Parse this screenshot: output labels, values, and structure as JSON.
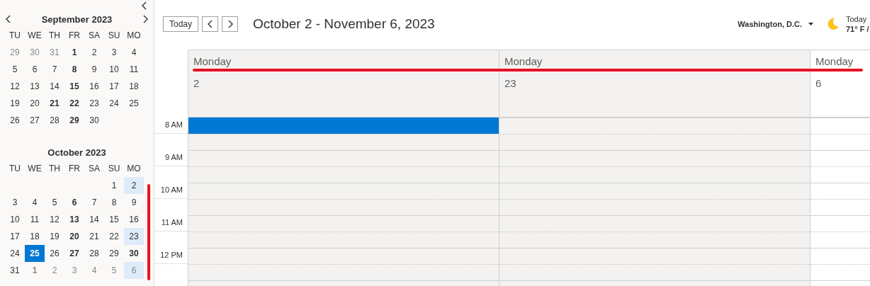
{
  "sidebar": {
    "mini_calendars": [
      {
        "title": "September 2023",
        "weekdays": [
          "TU",
          "WE",
          "TH",
          "FR",
          "SA",
          "SU",
          "MO"
        ],
        "weeks": [
          [
            {
              "d": "29",
              "muted": true,
              "bold": false,
              "selected": false,
              "today": false
            },
            {
              "d": "30",
              "muted": true,
              "bold": false,
              "selected": false,
              "today": false
            },
            {
              "d": "31",
              "muted": true,
              "bold": false,
              "selected": false,
              "today": false
            },
            {
              "d": "1",
              "muted": false,
              "bold": true,
              "selected": false,
              "today": false
            },
            {
              "d": "2",
              "muted": false,
              "bold": false,
              "selected": false,
              "today": false
            },
            {
              "d": "3",
              "muted": false,
              "bold": false,
              "selected": false,
              "today": false
            },
            {
              "d": "4",
              "muted": false,
              "bold": false,
              "selected": false,
              "today": false
            }
          ],
          [
            {
              "d": "5",
              "muted": false,
              "bold": false,
              "selected": false,
              "today": false
            },
            {
              "d": "6",
              "muted": false,
              "bold": false,
              "selected": false,
              "today": false
            },
            {
              "d": "7",
              "muted": false,
              "bold": false,
              "selected": false,
              "today": false
            },
            {
              "d": "8",
              "muted": false,
              "bold": true,
              "selected": false,
              "today": false
            },
            {
              "d": "9",
              "muted": false,
              "bold": false,
              "selected": false,
              "today": false
            },
            {
              "d": "10",
              "muted": false,
              "bold": false,
              "selected": false,
              "today": false
            },
            {
              "d": "11",
              "muted": false,
              "bold": false,
              "selected": false,
              "today": false
            }
          ],
          [
            {
              "d": "12",
              "muted": false,
              "bold": false,
              "selected": false,
              "today": false
            },
            {
              "d": "13",
              "muted": false,
              "bold": false,
              "selected": false,
              "today": false
            },
            {
              "d": "14",
              "muted": false,
              "bold": false,
              "selected": false,
              "today": false
            },
            {
              "d": "15",
              "muted": false,
              "bold": true,
              "selected": false,
              "today": false
            },
            {
              "d": "16",
              "muted": false,
              "bold": false,
              "selected": false,
              "today": false
            },
            {
              "d": "17",
              "muted": false,
              "bold": false,
              "selected": false,
              "today": false
            },
            {
              "d": "18",
              "muted": false,
              "bold": false,
              "selected": false,
              "today": false
            }
          ],
          [
            {
              "d": "19",
              "muted": false,
              "bold": false,
              "selected": false,
              "today": false
            },
            {
              "d": "20",
              "muted": false,
              "bold": false,
              "selected": false,
              "today": false
            },
            {
              "d": "21",
              "muted": false,
              "bold": true,
              "selected": false,
              "today": false
            },
            {
              "d": "22",
              "muted": false,
              "bold": true,
              "selected": false,
              "today": false
            },
            {
              "d": "23",
              "muted": false,
              "bold": false,
              "selected": false,
              "today": false
            },
            {
              "d": "24",
              "muted": false,
              "bold": false,
              "selected": false,
              "today": false
            },
            {
              "d": "25",
              "muted": false,
              "bold": false,
              "selected": false,
              "today": false
            }
          ],
          [
            {
              "d": "26",
              "muted": false,
              "bold": false,
              "selected": false,
              "today": false
            },
            {
              "d": "27",
              "muted": false,
              "bold": false,
              "selected": false,
              "today": false
            },
            {
              "d": "28",
              "muted": false,
              "bold": false,
              "selected": false,
              "today": false
            },
            {
              "d": "29",
              "muted": false,
              "bold": true,
              "selected": false,
              "today": false
            },
            {
              "d": "30",
              "muted": false,
              "bold": false,
              "selected": false,
              "today": false
            }
          ]
        ]
      },
      {
        "title": "October 2023",
        "weekdays": [
          "TU",
          "WE",
          "TH",
          "FR",
          "SA",
          "SU",
          "MO"
        ],
        "weeks": [
          [
            {
              "kind": "blank"
            },
            {
              "kind": "blank"
            },
            {
              "kind": "blank"
            },
            {
              "kind": "blank"
            },
            {
              "kind": "blank"
            },
            {
              "kind": "day",
              "d": "1",
              "muted": false,
              "bold": false,
              "selected": false,
              "today": false
            },
            {
              "kind": "day",
              "d": "2",
              "muted": false,
              "bold": false,
              "selected": true,
              "today": false
            }
          ],
          [
            {
              "kind": "day",
              "d": "3",
              "muted": false,
              "bold": false,
              "selected": false,
              "today": false
            },
            {
              "kind": "day",
              "d": "4",
              "muted": false,
              "bold": false,
              "selected": false,
              "today": false
            },
            {
              "kind": "day",
              "d": "5",
              "muted": false,
              "bold": false,
              "selected": false,
              "today": false
            },
            {
              "kind": "day",
              "d": "6",
              "muted": false,
              "bold": true,
              "selected": false,
              "today": false
            },
            {
              "kind": "day",
              "d": "7",
              "muted": false,
              "bold": false,
              "selected": false,
              "today": false
            },
            {
              "kind": "day",
              "d": "8",
              "muted": false,
              "bold": false,
              "selected": false,
              "today": false
            },
            {
              "kind": "day",
              "d": "9",
              "muted": false,
              "bold": false,
              "selected": false,
              "today": false
            }
          ],
          [
            {
              "kind": "day",
              "d": "10",
              "muted": false,
              "bold": false,
              "selected": false,
              "today": false
            },
            {
              "kind": "day",
              "d": "11",
              "muted": false,
              "bold": false,
              "selected": false,
              "today": false
            },
            {
              "kind": "day",
              "d": "12",
              "muted": false,
              "bold": false,
              "selected": false,
              "today": false
            },
            {
              "kind": "day",
              "d": "13",
              "muted": false,
              "bold": true,
              "selected": false,
              "today": false
            },
            {
              "kind": "day",
              "d": "14",
              "muted": false,
              "bold": false,
              "selected": false,
              "today": false
            },
            {
              "kind": "day",
              "d": "15",
              "muted": false,
              "bold": false,
              "selected": false,
              "today": false
            },
            {
              "kind": "day",
              "d": "16",
              "muted": false,
              "bold": false,
              "selected": false,
              "today": false
            }
          ],
          [
            {
              "kind": "day",
              "d": "17",
              "muted": false,
              "bold": false,
              "selected": false,
              "today": false
            },
            {
              "kind": "day",
              "d": "18",
              "muted": false,
              "bold": false,
              "selected": false,
              "today": false
            },
            {
              "kind": "day",
              "d": "19",
              "muted": false,
              "bold": false,
              "selected": false,
              "today": false
            },
            {
              "kind": "day",
              "d": "20",
              "muted": false,
              "bold": true,
              "selected": false,
              "today": false
            },
            {
              "kind": "day",
              "d": "21",
              "muted": false,
              "bold": false,
              "selected": false,
              "today": false
            },
            {
              "kind": "day",
              "d": "22",
              "muted": false,
              "bold": false,
              "selected": false,
              "today": false
            },
            {
              "kind": "day",
              "d": "23",
              "muted": false,
              "bold": false,
              "selected": true,
              "today": false
            }
          ],
          [
            {
              "kind": "day",
              "d": "24",
              "muted": false,
              "bold": false,
              "selected": false,
              "today": false
            },
            {
              "kind": "day",
              "d": "25",
              "muted": false,
              "bold": true,
              "selected": false,
              "today": true
            },
            {
              "kind": "day",
              "d": "26",
              "muted": false,
              "bold": false,
              "selected": false,
              "today": false
            },
            {
              "kind": "day",
              "d": "27",
              "muted": false,
              "bold": true,
              "selected": false,
              "today": false
            },
            {
              "kind": "day",
              "d": "28",
              "muted": false,
              "bold": false,
              "selected": false,
              "today": false
            },
            {
              "kind": "day",
              "d": "29",
              "muted": false,
              "bold": false,
              "selected": false,
              "today": false
            },
            {
              "kind": "day",
              "d": "30",
              "muted": false,
              "bold": true,
              "selected": false,
              "today": false
            }
          ],
          [
            {
              "kind": "day",
              "d": "31",
              "muted": false,
              "bold": false,
              "selected": false,
              "today": false
            },
            {
              "kind": "day",
              "d": "1",
              "muted": true,
              "bold": true,
              "selected": false,
              "today": false
            },
            {
              "kind": "day",
              "d": "2",
              "muted": true,
              "bold": false,
              "selected": false,
              "today": false
            },
            {
              "kind": "day",
              "d": "3",
              "muted": true,
              "bold": false,
              "selected": false,
              "today": false
            },
            {
              "kind": "day",
              "d": "4",
              "muted": true,
              "bold": false,
              "selected": false,
              "today": false
            },
            {
              "kind": "day",
              "d": "5",
              "muted": true,
              "bold": false,
              "selected": false,
              "today": false
            },
            {
              "kind": "day",
              "d": "6",
              "muted": true,
              "bold": false,
              "selected": true,
              "today": false
            }
          ]
        ]
      }
    ]
  },
  "toolbar": {
    "today_button": "Today",
    "title": "October 2 - November 6, 2023"
  },
  "weather": {
    "location": "Washington, D.C.",
    "label": "Today",
    "temperature": "71° F /"
  },
  "time_slots": [
    "8 AM",
    "9 AM",
    "10 AM",
    "11 AM",
    "12 PM"
  ],
  "days": [
    {
      "weekday": "Monday",
      "date": "2",
      "shaded": true,
      "events": [
        {
          "kind": "block"
        }
      ]
    },
    {
      "weekday": "Monday",
      "date": "23",
      "shaded": true
    },
    {
      "weekday": "Monday",
      "date": "6",
      "shaded": false
    }
  ],
  "annotations": {
    "underline": true,
    "side_bar": true
  }
}
